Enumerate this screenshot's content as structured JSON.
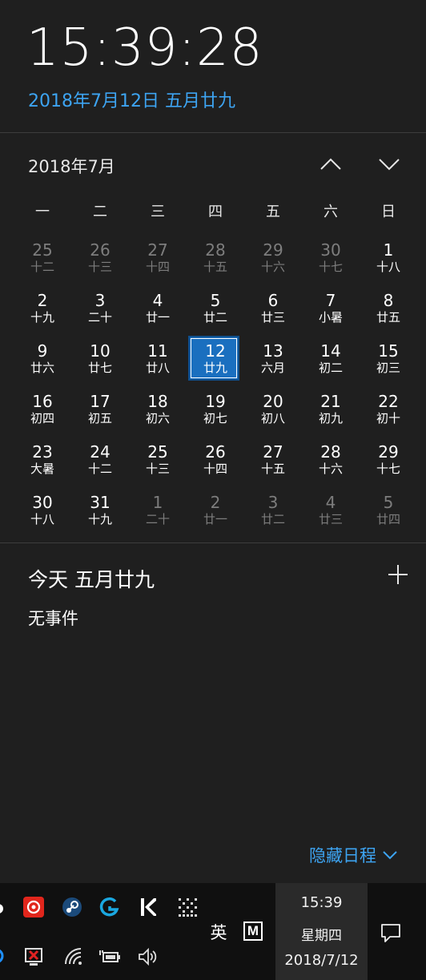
{
  "header": {
    "time": "15:39:28",
    "full_date": "2018年7月12日 五月廿九"
  },
  "calendar": {
    "month_label": "2018年7月",
    "weekdays": [
      "一",
      "二",
      "三",
      "四",
      "五",
      "六",
      "日"
    ],
    "days": [
      {
        "num": "25",
        "lunar": "十二",
        "other": true
      },
      {
        "num": "26",
        "lunar": "十三",
        "other": true
      },
      {
        "num": "27",
        "lunar": "十四",
        "other": true
      },
      {
        "num": "28",
        "lunar": "十五",
        "other": true
      },
      {
        "num": "29",
        "lunar": "十六",
        "other": true
      },
      {
        "num": "30",
        "lunar": "十七",
        "other": true
      },
      {
        "num": "1",
        "lunar": "十八",
        "other": false
      },
      {
        "num": "2",
        "lunar": "十九",
        "other": false
      },
      {
        "num": "3",
        "lunar": "二十",
        "other": false
      },
      {
        "num": "4",
        "lunar": "廿一",
        "other": false
      },
      {
        "num": "5",
        "lunar": "廿二",
        "other": false
      },
      {
        "num": "6",
        "lunar": "廿三",
        "other": false
      },
      {
        "num": "7",
        "lunar": "小暑",
        "other": false
      },
      {
        "num": "8",
        "lunar": "廿五",
        "other": false
      },
      {
        "num": "9",
        "lunar": "廿六",
        "other": false
      },
      {
        "num": "10",
        "lunar": "廿七",
        "other": false
      },
      {
        "num": "11",
        "lunar": "廿八",
        "other": false
      },
      {
        "num": "12",
        "lunar": "廿九",
        "other": false,
        "today": true
      },
      {
        "num": "13",
        "lunar": "六月",
        "other": false
      },
      {
        "num": "14",
        "lunar": "初二",
        "other": false
      },
      {
        "num": "15",
        "lunar": "初三",
        "other": false
      },
      {
        "num": "16",
        "lunar": "初四",
        "other": false
      },
      {
        "num": "17",
        "lunar": "初五",
        "other": false
      },
      {
        "num": "18",
        "lunar": "初六",
        "other": false
      },
      {
        "num": "19",
        "lunar": "初七",
        "other": false
      },
      {
        "num": "20",
        "lunar": "初八",
        "other": false
      },
      {
        "num": "21",
        "lunar": "初九",
        "other": false
      },
      {
        "num": "22",
        "lunar": "初十",
        "other": false
      },
      {
        "num": "23",
        "lunar": "大暑",
        "other": false
      },
      {
        "num": "24",
        "lunar": "十二",
        "other": false
      },
      {
        "num": "25",
        "lunar": "十三",
        "other": false
      },
      {
        "num": "26",
        "lunar": "十四",
        "other": false
      },
      {
        "num": "27",
        "lunar": "十五",
        "other": false
      },
      {
        "num": "28",
        "lunar": "十六",
        "other": false
      },
      {
        "num": "29",
        "lunar": "十七",
        "other": false
      },
      {
        "num": "30",
        "lunar": "十八",
        "other": false
      },
      {
        "num": "31",
        "lunar": "十九",
        "other": false
      },
      {
        "num": "1",
        "lunar": "二十",
        "other": true
      },
      {
        "num": "2",
        "lunar": "廿一",
        "other": true
      },
      {
        "num": "3",
        "lunar": "廿二",
        "other": true
      },
      {
        "num": "4",
        "lunar": "廿三",
        "other": true
      },
      {
        "num": "5",
        "lunar": "廿四",
        "other": true
      }
    ]
  },
  "agenda": {
    "title": "今天 五月廿九",
    "empty_text": "无事件",
    "hide_label": "隐藏日程"
  },
  "taskbar": {
    "ime_label": "英",
    "ime_mode": "M",
    "clock_time": "15:39",
    "clock_weekday": "星期四",
    "clock_date": "2018/7/12",
    "tray_icons": [
      "netease-music-icon",
      "steam-icon",
      "logitech-g-icon",
      "app-k-icon",
      "dotted-grid-icon",
      "network-error-icon",
      "wifi-icon",
      "battery-charging-icon",
      "volume-icon"
    ]
  },
  "colors": {
    "accent": "#3da4f2",
    "today_fill": "#1a6fbf",
    "background": "#1f1f1f",
    "taskbar": "#101010"
  }
}
